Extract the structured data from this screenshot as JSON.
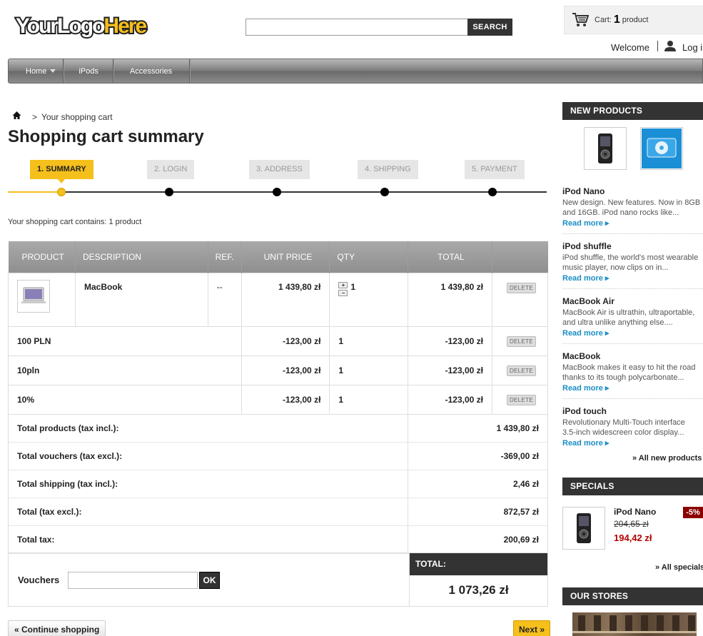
{
  "header": {
    "logo_text": "YourLogoHere",
    "search_placeholder": "",
    "search_button": "SEARCH",
    "cart_label": "Cart:",
    "cart_count": "1",
    "cart_unit": "product",
    "welcome": "Welcome",
    "login": "Log in"
  },
  "nav": [
    {
      "label": "Home",
      "has_dropdown": true
    },
    {
      "label": "iPods",
      "has_dropdown": false
    },
    {
      "label": "Accessories",
      "has_dropdown": false
    }
  ],
  "breadcrumb": {
    "sep": ">",
    "current": "Your shopping cart"
  },
  "page_title": "Shopping cart summary",
  "steps": [
    {
      "label": "1. SUMMARY",
      "active": true
    },
    {
      "label": "2. LOGIN",
      "active": false
    },
    {
      "label": "3. ADDRESS",
      "active": false
    },
    {
      "label": "4. SHIPPING",
      "active": false
    },
    {
      "label": "5. PAYMENT",
      "active": false
    }
  ],
  "cart_contains": "Your shopping cart contains: 1 product",
  "table": {
    "headers": {
      "product": "PRODUCT",
      "description": "DESCRIPTION",
      "ref": "REF.",
      "unit_price": "UNIT PRICE",
      "qty": "QTY",
      "total": "TOTAL"
    },
    "product": {
      "name": "MacBook",
      "ref": "--",
      "unit_price": "1 439,80 zł",
      "qty": "1",
      "total": "1 439,80 zł",
      "delete": "DELETE",
      "plus": "+",
      "minus": "−"
    },
    "discounts": [
      {
        "name": "100 PLN",
        "unit_price": "-123,00 zł",
        "qty": "1",
        "total": "-123,00 zł",
        "delete": "DELETE"
      },
      {
        "name": "10pln",
        "unit_price": "-123,00 zł",
        "qty": "1",
        "total": "-123,00 zł",
        "delete": "DELETE"
      },
      {
        "name": "10%",
        "unit_price": "-123,00 zł",
        "qty": "1",
        "total": "-123,00 zł",
        "delete": "DELETE"
      }
    ],
    "totals": [
      {
        "label": "Total products (tax incl.):",
        "value": "1 439,80 zł"
      },
      {
        "label": "Total vouchers (tax excl.):",
        "value": "-369,00 zł"
      },
      {
        "label": "Total shipping (tax incl.):",
        "value": "2,46 zł"
      },
      {
        "label": "Total (tax excl.):",
        "value": "872,57 zł"
      },
      {
        "label": "Total tax:",
        "value": "200,69 zł"
      }
    ],
    "vouchers_label": "Vouchers",
    "voucher_ok": "OK",
    "total_label": "TOTAL:",
    "total_value": "1 073,26 zł"
  },
  "buttons": {
    "continue": "« Continue shopping",
    "next": "Next »"
  },
  "sidebar": {
    "new_products_title": "NEW PRODUCTS",
    "new_products": [
      {
        "name": "iPod Nano",
        "desc1": "New design. New features. Now in 8GB",
        "desc2": "and 16GB. iPod nano rocks like...",
        "more": "Read more"
      },
      {
        "name": "iPod shuffle",
        "desc1": "iPod shuffle, the world's most wearable",
        "desc2": "music player, now clips on in...",
        "more": "Read more"
      },
      {
        "name": "MacBook Air",
        "desc1": "MacBook Air is ultrathin, ultraportable,",
        "desc2": "and ultra unlike anything else....",
        "more": "Read more"
      },
      {
        "name": "MacBook",
        "desc1": "MacBook makes it easy to hit the road",
        "desc2": "thanks to its tough polycarbonate...",
        "more": "Read more"
      },
      {
        "name": "iPod touch",
        "desc1": "Revolutionary Multi-Touch interface",
        "desc2": "3.5-inch widescreen color display...",
        "more": "Read more"
      }
    ],
    "all_new": "» All new products",
    "specials_title": "SPECIALS",
    "special": {
      "name": "iPod Nano",
      "old_price": "204,65 zł",
      "new_price": "194,42 zł",
      "discount": "-5%"
    },
    "all_specials": "» All specials",
    "stores_title": "OUR STORES"
  },
  "colors": {
    "accent": "#f5bf1c",
    "dark": "#333333",
    "link": "#1b8ec6",
    "sale": "#b30000"
  }
}
